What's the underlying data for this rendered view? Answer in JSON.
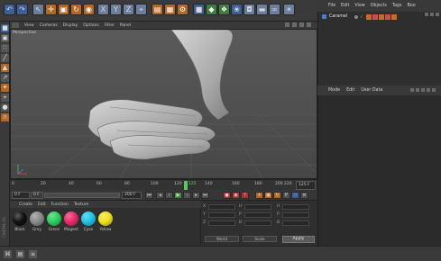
{
  "toolbar": {
    "icons": [
      {
        "name": "undo-icon",
        "glyph": "↶"
      },
      {
        "name": "redo-icon",
        "glyph": "↷"
      },
      {
        "name": "live-selection-icon",
        "glyph": "↖"
      },
      {
        "name": "move-icon",
        "glyph": "✛"
      },
      {
        "name": "scale-icon",
        "glyph": "▣"
      },
      {
        "name": "rotate-icon",
        "glyph": "↻"
      },
      {
        "name": "recent-tool-icon",
        "glyph": "◉"
      },
      {
        "name": "x-axis-icon",
        "glyph": "X"
      },
      {
        "name": "y-axis-icon",
        "glyph": "Y"
      },
      {
        "name": "z-axis-icon",
        "glyph": "Z"
      },
      {
        "name": "coordinate-system-icon",
        "glyph": "⌖"
      },
      {
        "name": "render-view-icon",
        "glyph": "▤"
      },
      {
        "name": "render-picture-viewer-icon",
        "glyph": "▦"
      },
      {
        "name": "render-settings-icon",
        "glyph": "⚙"
      },
      {
        "name": "cube-icon",
        "glyph": "■"
      },
      {
        "name": "subdivision-icon",
        "glyph": "◆"
      },
      {
        "name": "array-icon",
        "glyph": "❖"
      },
      {
        "name": "deformer-icon",
        "glyph": "❀"
      },
      {
        "name": "environment-icon",
        "glyph": "◘"
      },
      {
        "name": "camera-icon",
        "glyph": "▬"
      },
      {
        "name": "scene-icon",
        "glyph": "∞"
      },
      {
        "name": "light-icon",
        "glyph": "☀"
      }
    ]
  },
  "left_toolbar": {
    "icons": [
      {
        "name": "model-mode-icon",
        "glyph": "■"
      },
      {
        "name": "texture-mode-icon",
        "glyph": "▣"
      },
      {
        "name": "points-mode-icon",
        "glyph": "∷"
      },
      {
        "name": "edges-mode-icon",
        "glyph": "╱"
      },
      {
        "name": "polygons-mode-icon",
        "glyph": "▲"
      },
      {
        "name": "axis-mode-icon",
        "glyph": "↗"
      },
      {
        "name": "tweak-mode-icon",
        "glyph": "✦"
      },
      {
        "name": "snap-icon",
        "glyph": "⌖"
      },
      {
        "name": "sculpt-mode-icon",
        "glyph": "●"
      },
      {
        "name": "magnet-icon",
        "glyph": "∩"
      }
    ]
  },
  "viewport": {
    "menu": [
      "View",
      "Cameras",
      "Display",
      "Options",
      "Filter",
      "Panel"
    ],
    "label": "Perspective"
  },
  "timeline": {
    "ticks": [
      "0",
      "20",
      "40",
      "60",
      "80",
      "100",
      "120",
      "140",
      "160",
      "180",
      "200",
      "220"
    ],
    "current_frame": "125",
    "end_display": "125 F"
  },
  "transport": {
    "start_field": "0 F",
    "range_start": "0 F",
    "range_end": "200 F",
    "end_field": "200 F",
    "buttons": [
      {
        "name": "go-to-start-button",
        "glyph": "⏮"
      },
      {
        "name": "previous-key-button",
        "glyph": "◂"
      },
      {
        "name": "previous-frame-button",
        "glyph": "‹"
      },
      {
        "name": "play-button",
        "glyph": "▶"
      },
      {
        "name": "next-frame-button",
        "glyph": "›"
      },
      {
        "name": "next-key-button",
        "glyph": "▸"
      },
      {
        "name": "go-to-end-button",
        "glyph": "⏭"
      },
      {
        "name": "record-button",
        "glyph": "●"
      },
      {
        "name": "autokey-button",
        "glyph": "◉"
      },
      {
        "name": "keyframe-selection-button",
        "glyph": "?"
      },
      {
        "name": "position-key-button",
        "glyph": "✛"
      },
      {
        "name": "scale-key-button",
        "glyph": "▣"
      },
      {
        "name": "rotation-key-button",
        "glyph": "↻"
      },
      {
        "name": "parameter-key-button",
        "glyph": "P"
      },
      {
        "name": "point-level-key-button",
        "glyph": "∷"
      },
      {
        "name": "timeline-button",
        "glyph": "≡"
      }
    ]
  },
  "material_manager": {
    "menu": [
      "Create",
      "Edit",
      "Function",
      "Texture"
    ],
    "materials": [
      {
        "label": "Black",
        "color": "#101010"
      },
      {
        "label": "Grey",
        "color": "#8a8a8a"
      },
      {
        "label": "Green",
        "color": "#2bd15f"
      },
      {
        "label": "Magent",
        "color": "#ea2a6b"
      },
      {
        "label": "Cyan",
        "color": "#1ec4e8"
      },
      {
        "label": "Yellow",
        "color": "#f2e21a"
      }
    ],
    "side_label": "CINEMA 4D"
  },
  "coordinates": {
    "rows": [
      {
        "pos": "X",
        "size": "H",
        "rot": "H"
      },
      {
        "pos": "Y",
        "size": "P",
        "rot": "P"
      },
      {
        "pos": "Z",
        "size": "B",
        "rot": "B"
      }
    ],
    "mode_dropdown": "World",
    "size_dropdown": "Scale",
    "apply_label": "Apply"
  },
  "object_manager": {
    "menu": [
      "File",
      "Edit",
      "View",
      "Objects",
      "Tags",
      "Boo"
    ],
    "object_name": "Caramel"
  },
  "attribute_manager": {
    "menu": [
      "Mode",
      "Edit",
      "User Data"
    ]
  },
  "colors": {
    "accent_orange": "#b6661e",
    "accent_blue": "#3b5f99",
    "playhead_green": "#57c957",
    "viewport_bg": "#4f4f4f"
  }
}
